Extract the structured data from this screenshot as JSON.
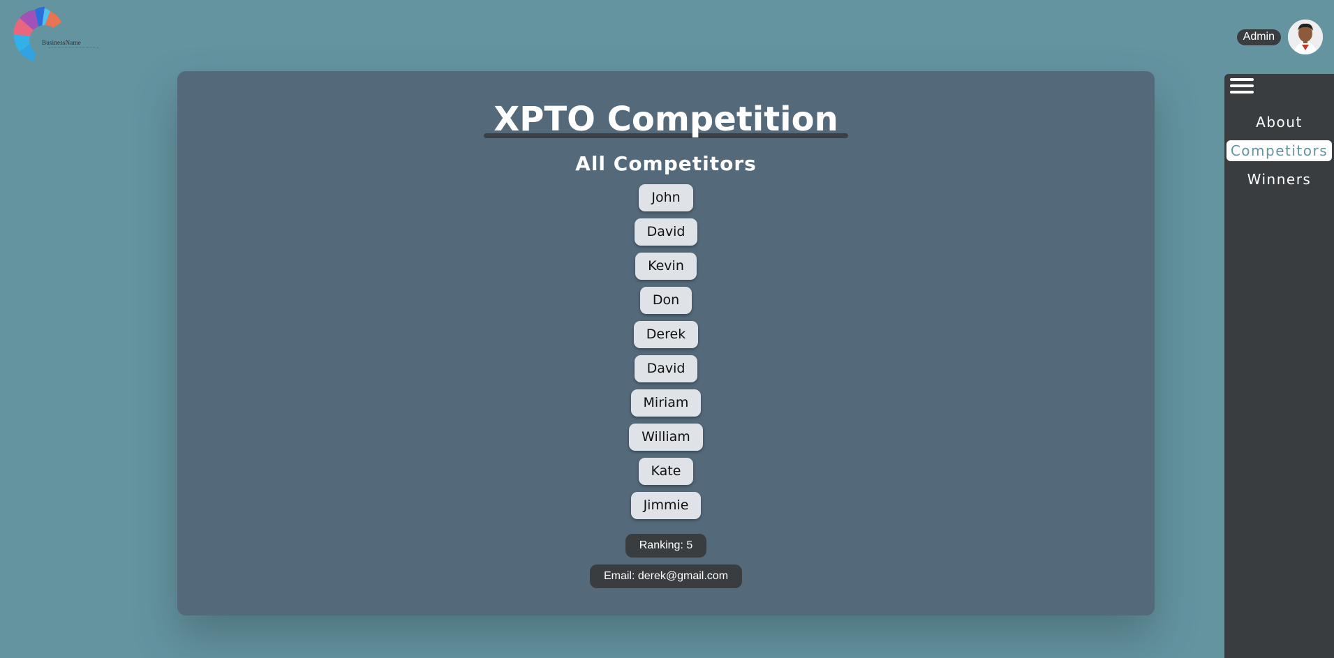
{
  "logo": {
    "brand_text": "BusinessName"
  },
  "user": {
    "role_label": "Admin",
    "avatar_icon": "user-avatar-icon"
  },
  "main": {
    "title": "XPTO Competition",
    "subtitle": "All Competitors",
    "competitors": [
      "John",
      "David",
      "Kevin",
      "Don",
      "Derek",
      "David",
      "Miriam",
      "William",
      "Kate",
      "Jimmie"
    ],
    "ranking": "Ranking: 5",
    "email": "Email: derek@gmail.com"
  },
  "sidenav": {
    "menu_icon": "hamburger-menu-icon",
    "items": [
      {
        "label": "About",
        "active": false
      },
      {
        "label": "Competitors",
        "active": true
      },
      {
        "label": "Winners",
        "active": false
      }
    ]
  },
  "colors": {
    "background": "#6494a0",
    "card": "#546a7b",
    "sidenav": "#3a3d40",
    "accent": "#6494a0"
  }
}
